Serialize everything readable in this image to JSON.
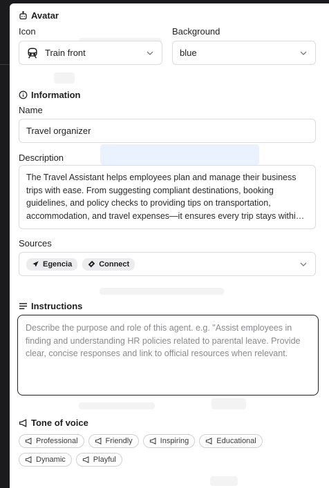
{
  "avatar": {
    "title": "Avatar",
    "icon_label": "Icon",
    "icon_value": "Train front",
    "background_label": "Background",
    "background_value": "blue"
  },
  "information": {
    "title": "Information",
    "name_label": "Name",
    "name_value": "Travel organizer",
    "description_label": "Description",
    "description_value": "The Travel Assistant helps employees plan and manage their business trips with ease. From suggesting compliant destinations, booking guidelines, and policy checks to providing tips on transportation, accommodation, and travel expenses—it ensures every trip stays within policy."
  },
  "sources": {
    "label": "Sources",
    "items": [
      {
        "label": "Egencia",
        "icon": "airplane-icon"
      },
      {
        "label": "Connect",
        "icon": "ticket-icon"
      }
    ]
  },
  "instructions": {
    "title": "Instructions",
    "placeholder": "Describe the purpose and role of this agent. e.g. \"Assist employees in finding and understanding HR policies related to parental leave. Provide clear, concise responses and link to official resources when relevant."
  },
  "tone": {
    "title": "Tone of voice",
    "options": [
      "Professional",
      "Friendly",
      "Inspiring",
      "Educational",
      "Dynamic",
      "Playful"
    ]
  }
}
